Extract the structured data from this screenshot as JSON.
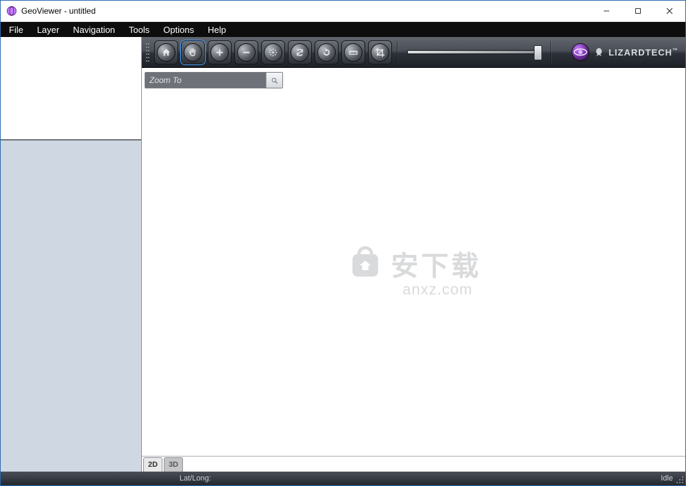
{
  "window": {
    "title": "GeoViewer - untitled"
  },
  "menubar": {
    "items": [
      "File",
      "Layer",
      "Navigation",
      "Tools",
      "Options",
      "Help"
    ]
  },
  "toolbar": {
    "buttons": [
      {
        "name": "home-icon",
        "title": "Home"
      },
      {
        "name": "pan-icon",
        "title": "Pan",
        "active": true
      },
      {
        "name": "zoom-in-icon",
        "title": "Zoom In"
      },
      {
        "name": "zoom-out-icon",
        "title": "Zoom Out"
      },
      {
        "name": "fit-icon",
        "title": "Zoom to Fit"
      },
      {
        "name": "sync-icon",
        "title": "Refresh"
      },
      {
        "name": "rotate-icon",
        "title": "Rotate"
      },
      {
        "name": "measure-icon",
        "title": "Measure"
      },
      {
        "name": "crop-icon",
        "title": "Crop"
      }
    ],
    "brand": {
      "text": "LIZARDTECH",
      "trademark": "™"
    }
  },
  "search": {
    "placeholder": "Zoom To"
  },
  "watermark": {
    "text": "安下载",
    "url": "anxz.com"
  },
  "viewtabs": {
    "tab_2d": "2D",
    "tab_3d": "3D",
    "active": "2D"
  },
  "statusbar": {
    "latlong_label": "Lat/Long:",
    "state": "Idle"
  }
}
